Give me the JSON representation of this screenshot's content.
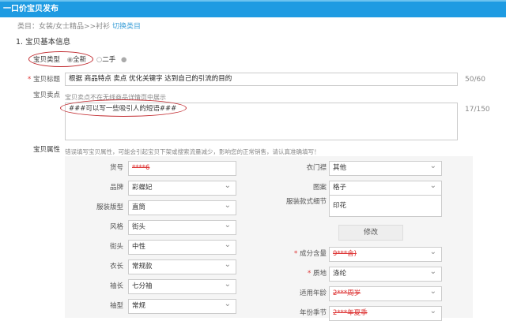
{
  "header": {
    "title": "一口价宝贝发布"
  },
  "category": {
    "text": "类目：女装/女士精品>>衬衫",
    "switch_label": "切换类目"
  },
  "section": {
    "title": "1. 宝贝基本信息"
  },
  "item_type": {
    "label": "宝贝类型",
    "options": [
      "全新",
      "二手"
    ],
    "selected": "全新"
  },
  "item_title": {
    "label": "宝贝标题",
    "value": "根据 商品特点 卖点 优化关键字 达到自己的引流的目的",
    "count": "50/60"
  },
  "selling_point": {
    "label": "宝贝卖点",
    "hint": "宝贝卖点不在无线商品详情页中展示",
    "value": "###可以写一些吸引人的短语###",
    "count": "17/150"
  },
  "attributes": {
    "label": "宝贝属性",
    "hint": "错误填写宝贝属性，可能会引起宝贝下架或搜索流量减少，影响您的正常销售，请认真准确填写！",
    "left": [
      {
        "label": "货号",
        "value": "****6",
        "type": "input",
        "redacted": true
      },
      {
        "label": "品牌",
        "value": "彩蝶妃",
        "type": "select"
      },
      {
        "label": "服装版型",
        "value": "直筒",
        "type": "select"
      },
      {
        "label": "风格",
        "value": "街头",
        "type": "select"
      },
      {
        "label": "街头",
        "value": "中性",
        "type": "select"
      },
      {
        "label": "衣长",
        "value": "常规款",
        "type": "select"
      },
      {
        "label": "袖长",
        "value": "七分袖",
        "type": "select"
      },
      {
        "label": "袖型",
        "value": "常规",
        "type": "select"
      }
    ],
    "right": [
      {
        "label": "衣门襟",
        "value": "其他",
        "type": "select"
      },
      {
        "label": "图案",
        "value": "格子",
        "type": "select"
      },
      {
        "label": "服装款式细节",
        "value": "印花",
        "type": "input"
      },
      {
        "label": "成分含量",
        "value": "9***含)",
        "type": "select",
        "required": true,
        "redacted": true
      },
      {
        "label": "质地",
        "value": "涤纶",
        "type": "select",
        "required": true
      },
      {
        "label": "适用年龄",
        "value": "2***周岁",
        "type": "select",
        "redacted": true
      },
      {
        "label": "年份季节",
        "value": "2***年夏季",
        "type": "select",
        "redacted": true
      }
    ],
    "edit_label": "修改"
  }
}
